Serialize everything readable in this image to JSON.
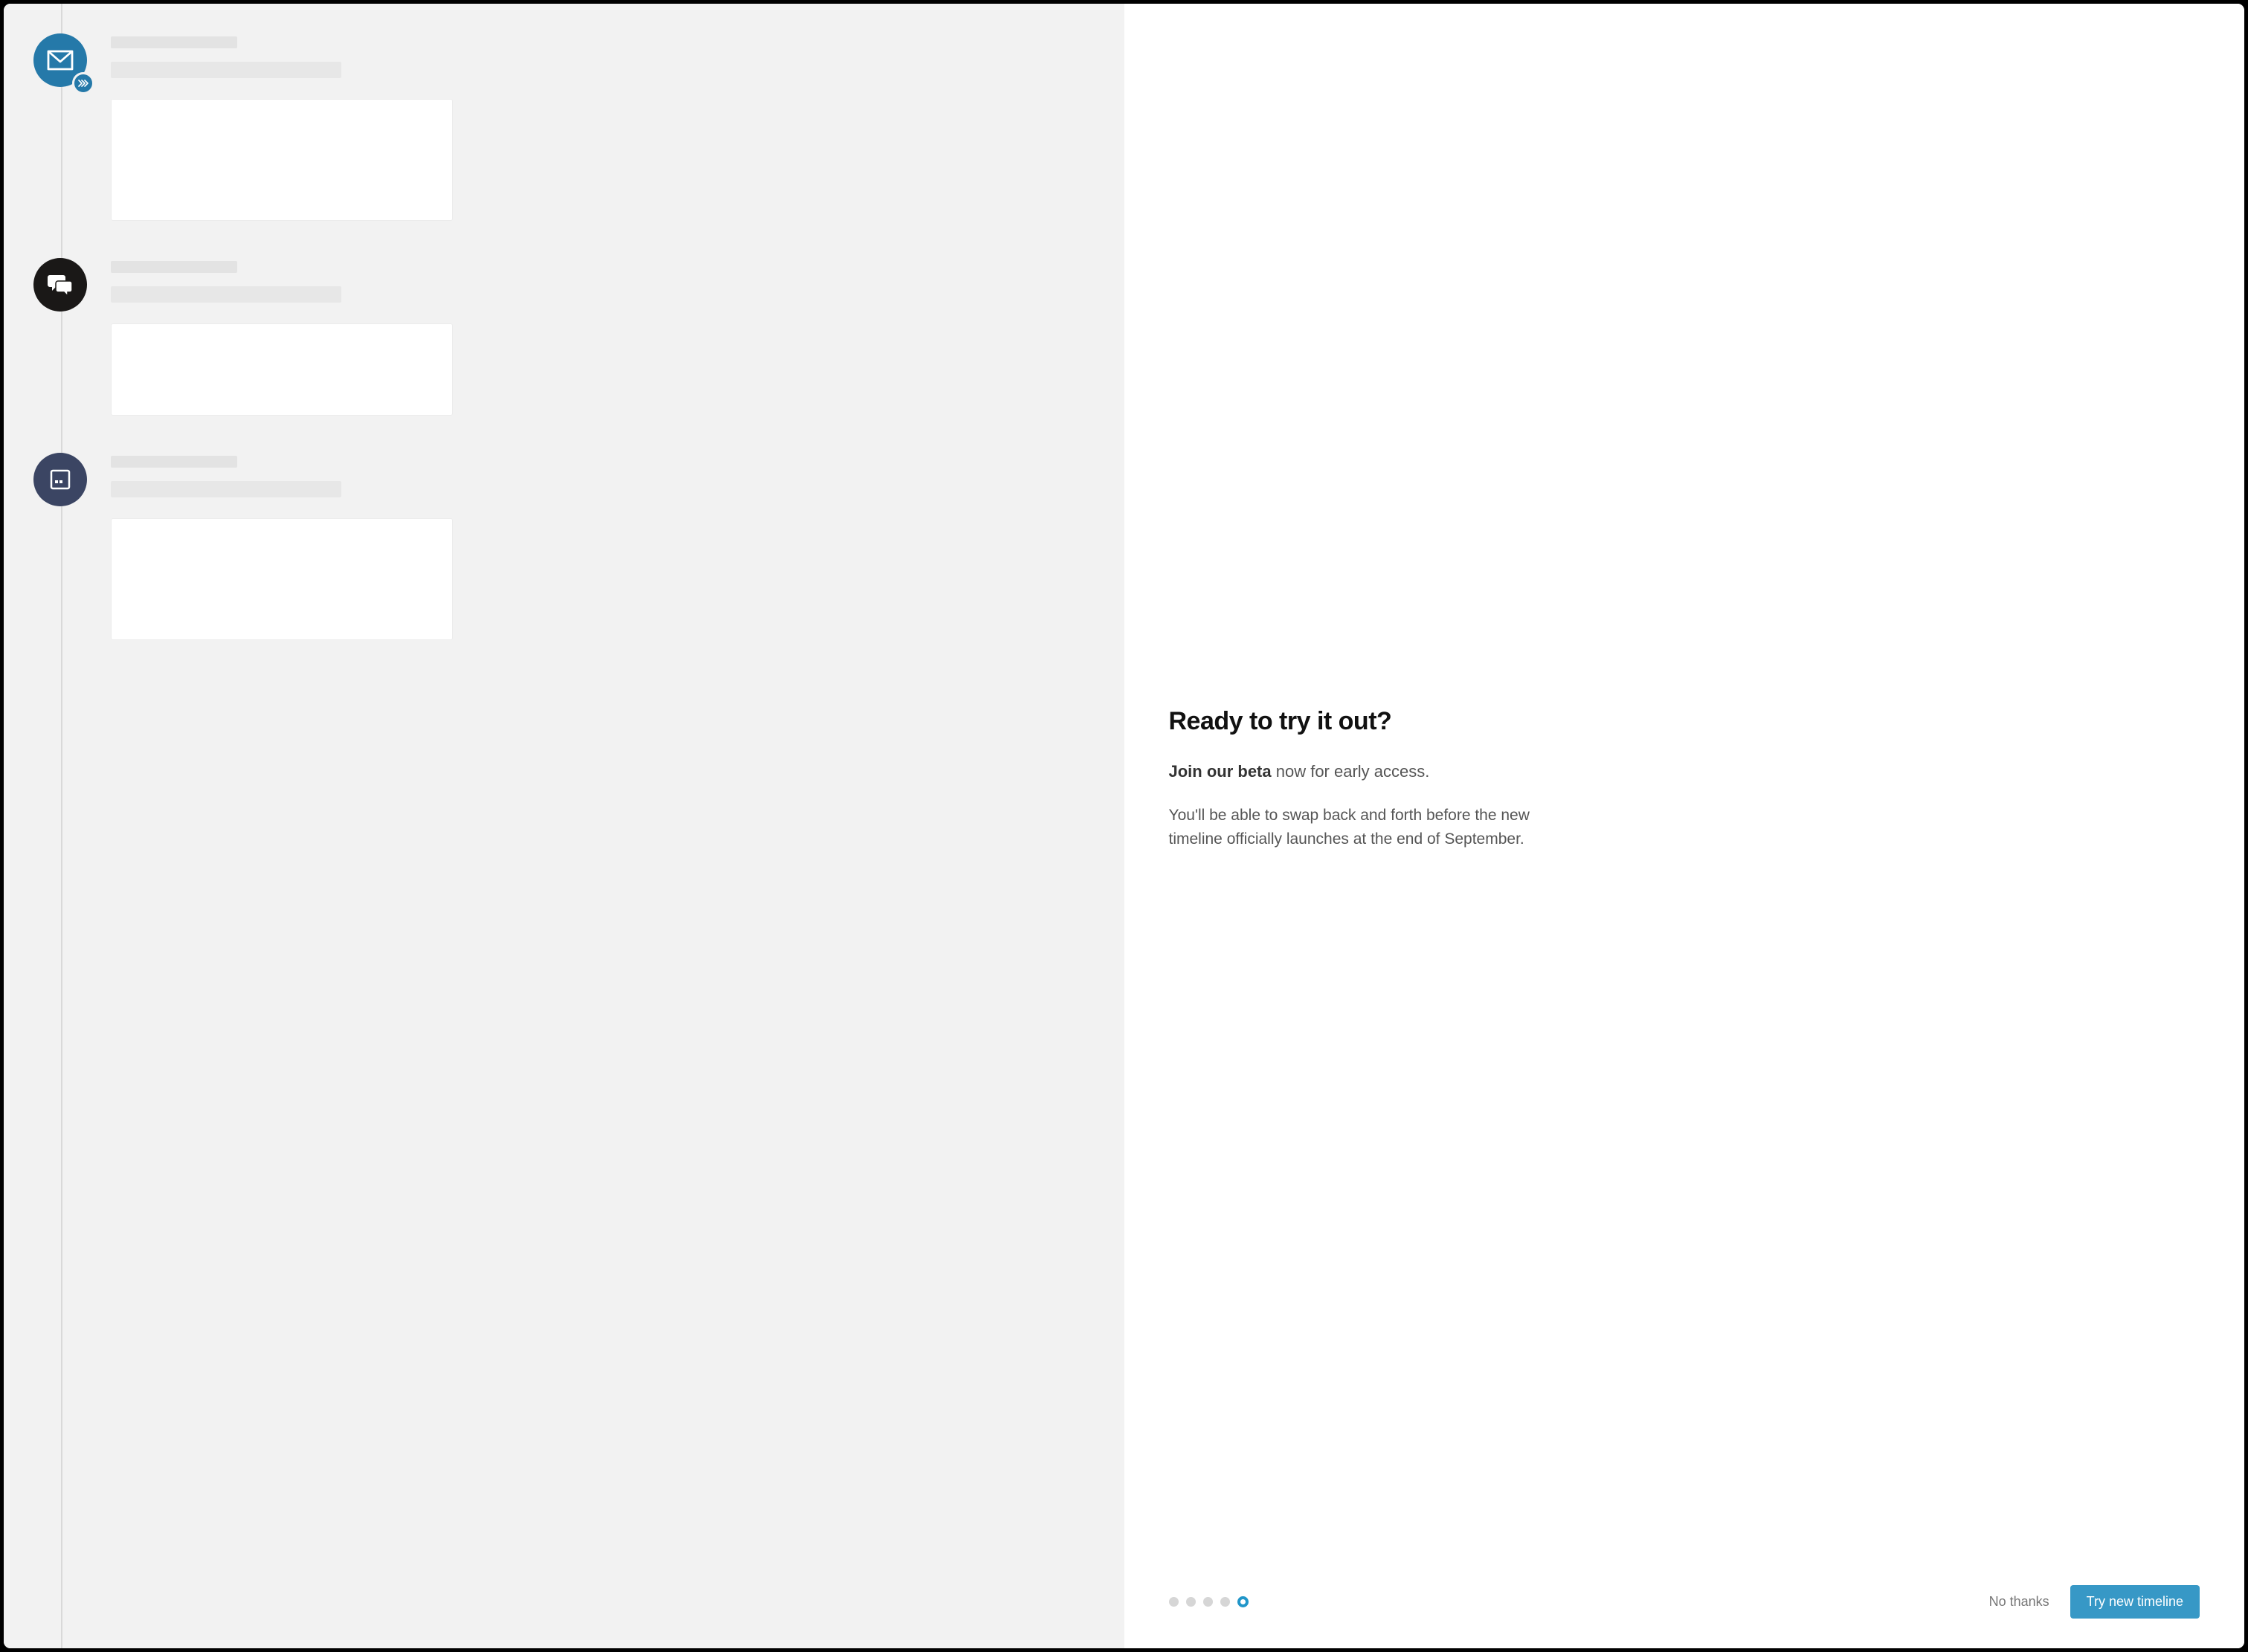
{
  "colors": {
    "accent_blue": "#2579a9",
    "button_blue": "#3798c6",
    "icon_black": "#1a1817",
    "icon_navy": "#3b4563"
  },
  "timeline": {
    "items": [
      {
        "icon": "envelope-icon",
        "badge": "skip-forward-icon"
      },
      {
        "icon": "chat-icon"
      },
      {
        "icon": "calendar-icon"
      }
    ]
  },
  "modal": {
    "heading": "Ready to try it out?",
    "sub_bold": "Join our beta",
    "sub_rest": " now for early access.",
    "body": "You'll be able to swap back and forth before the new timeline officially launches at the end of September."
  },
  "pagination": {
    "count": 5,
    "active_index": 4
  },
  "actions": {
    "dismiss": "No thanks",
    "confirm": "Try new timeline"
  }
}
